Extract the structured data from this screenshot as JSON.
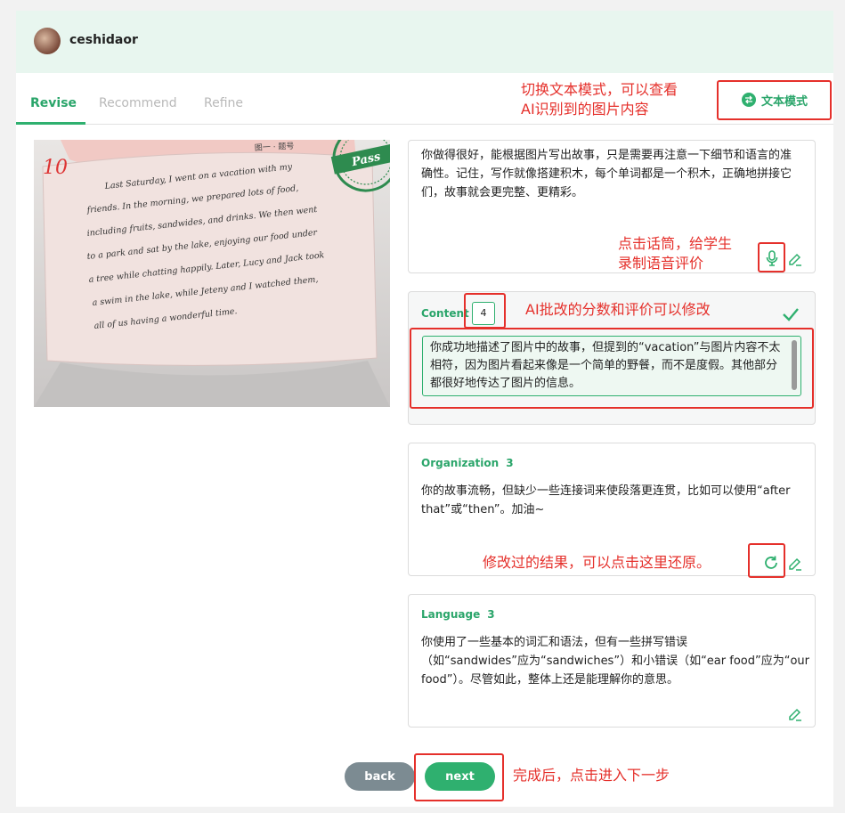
{
  "header": {
    "username": "ceshidaor"
  },
  "tabs": [
    "Revise",
    "Recommend",
    "Refine"
  ],
  "mode_button": {
    "label": "文本模式"
  },
  "annotations": {
    "mode_1": "切换文本模式，可以查看",
    "mode_2": "AI识别到的图片内容",
    "mic_1": "点击话筒，给学生",
    "mic_2": "录制语音评价",
    "score": "AI批改的分数和评价可以修改",
    "restore": "修改过的结果，可以点击这里还原。",
    "next": "完成后，点击进入下一步"
  },
  "photo": {
    "grade_mark": "10",
    "stamp_text": "Pass",
    "header_note": "图一 · 题号",
    "lines": [
      "Last Saturday, I went on a vacation with my",
      "friends. In the morning, we prepared lots of food,",
      "including fruits, sandwides, and drinks. We then went",
      "to a park and sat by the lake, enjoying our food under",
      "a tree while chatting happily. Later, Lucy and Jack took",
      "a swim in the lake, while Jeteny and I watched them,",
      "all of us having a wonderful time."
    ]
  },
  "overall": {
    "text": "你做得很好，能根据图片写出故事，只是需要再注意一下细节和语言的准确性。记住，写作就像搭建积木，每个单词都是一个积木，正确地拼接它们，故事就会更完整、更精彩。"
  },
  "content": {
    "label": "Content",
    "score": "4",
    "comment": "你成功地描述了图片中的故事，但提到的“vacation”与图片内容不太相符，因为图片看起来像是一个简单的野餐，而不是度假。其他部分都很好地传达了图片的信息。"
  },
  "organization": {
    "label": "Organization",
    "score": "3",
    "comment": "你的故事流畅，但缺少一些连接词来使段落更连贯，比如可以使用“after that”或“then”。加油~"
  },
  "language": {
    "label": "Language",
    "score": "3",
    "comment_1": "你使用了一些基本的词汇和语法，但有一些拼写错误",
    "comment_2": "（如“sandwides”应为“sandwiches”）和小错误（如“ear food”应为“our food”）。尽管如此，整体上还是能理解你的意思。"
  },
  "buttons": {
    "back": "back",
    "next": "next"
  },
  "colors": {
    "accent": "#2fb06f",
    "annotation": "#e5302b",
    "header_bg": "#e8f6ef",
    "back_btn": "#7c8b92"
  }
}
